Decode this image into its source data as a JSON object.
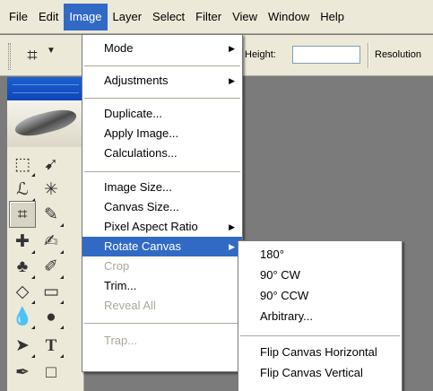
{
  "menubar": {
    "items": [
      "File",
      "Edit",
      "Image",
      "Layer",
      "Select",
      "Filter",
      "View",
      "Window",
      "Help"
    ],
    "active": "Image"
  },
  "options_bar": {
    "height_label": "Height:",
    "height_value": "",
    "resolution_label": "Resolution"
  },
  "image_menu": {
    "mode": "Mode",
    "adjustments": "Adjustments",
    "duplicate": "Duplicate...",
    "apply_image": "Apply Image...",
    "calculations": "Calculations...",
    "image_size": "Image Size...",
    "canvas_size": "Canvas Size...",
    "pixel_aspect_ratio": "Pixel Aspect Ratio",
    "rotate_canvas": "Rotate Canvas",
    "crop": "Crop",
    "trim": "Trim...",
    "reveal_all": "Reveal All",
    "trap": "Trap..."
  },
  "rotate_menu": {
    "r180": "180°",
    "cw90": "90° CW",
    "ccw90": "90° CCW",
    "arbitrary": "Arbitrary...",
    "flip_h": "Flip Canvas Horizontal",
    "flip_v": "Flip Canvas Vertical"
  },
  "colors": {
    "highlight": "#316ac5",
    "disabled_text": "#aca899",
    "canvas_bg": "#7b7b7b",
    "chrome": "#ece9d8"
  },
  "icons": {
    "submenu_arrow": "▶",
    "dropdown_arrow": "▼",
    "crop_glyph": "⌗"
  }
}
